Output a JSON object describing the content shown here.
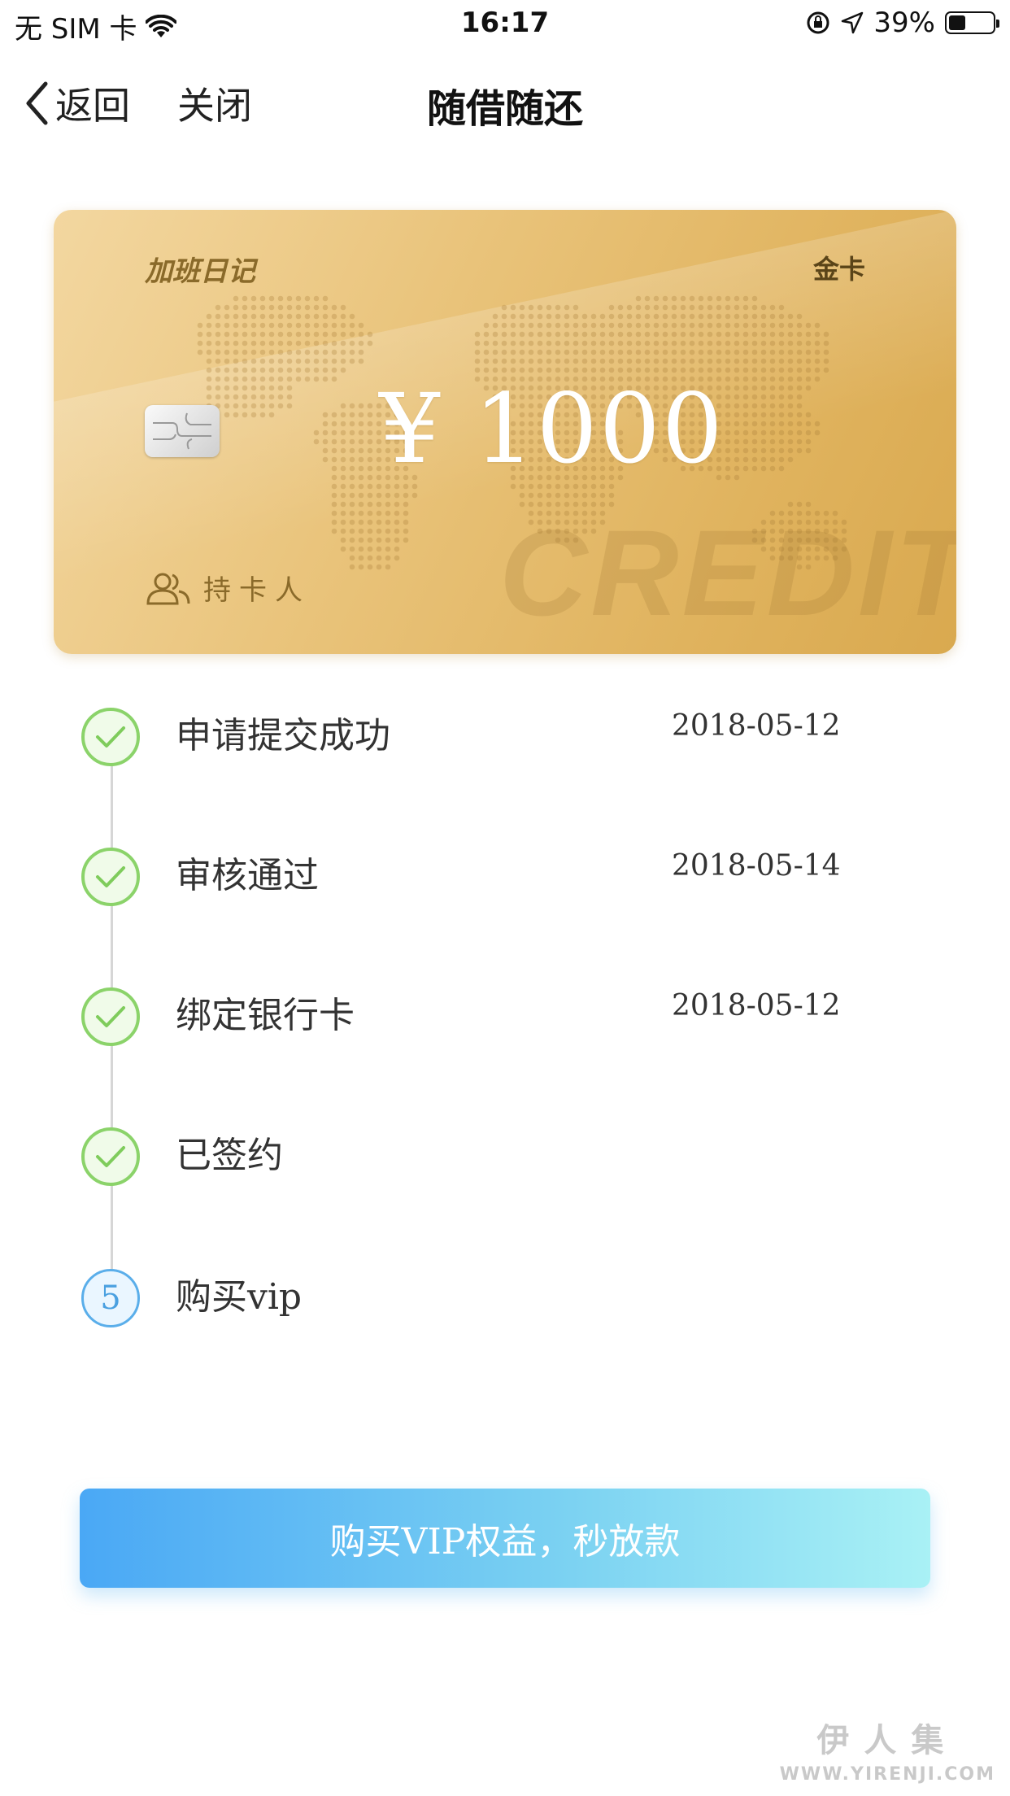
{
  "status_bar": {
    "carrier": "无 SIM 卡",
    "time": "16:17",
    "battery_percent": "39%",
    "battery_level": 0.39
  },
  "nav": {
    "back_label": "返回",
    "close_label": "关闭",
    "title": "随借随还"
  },
  "card": {
    "brand": "加班日记",
    "tier": "金卡",
    "amount": "¥ 1000",
    "watermark_text": "CREDIT",
    "holder_label": "持卡人"
  },
  "steps": [
    {
      "label": "申请提交成功",
      "date": "2018-05-12",
      "status": "done"
    },
    {
      "label": "审核通过",
      "date": "2018-05-14",
      "status": "done"
    },
    {
      "label": "绑定银行卡",
      "date": "2018-05-12",
      "status": "done"
    },
    {
      "label": "已签约",
      "date": "",
      "status": "done"
    },
    {
      "label": "购买vip",
      "date": "",
      "status": "current",
      "number": "5"
    }
  ],
  "cta": {
    "label": "购买VIP权益，秒放款"
  },
  "watermark": {
    "cn": "伊人集",
    "en": "WWW.YIRENJI.COM"
  },
  "colors": {
    "check_green": "#8bd36a",
    "current_blue": "#5aaeea",
    "card_gold": "#e2b665",
    "button_start": "#4aa8f5",
    "button_end": "#a9f1f5"
  }
}
